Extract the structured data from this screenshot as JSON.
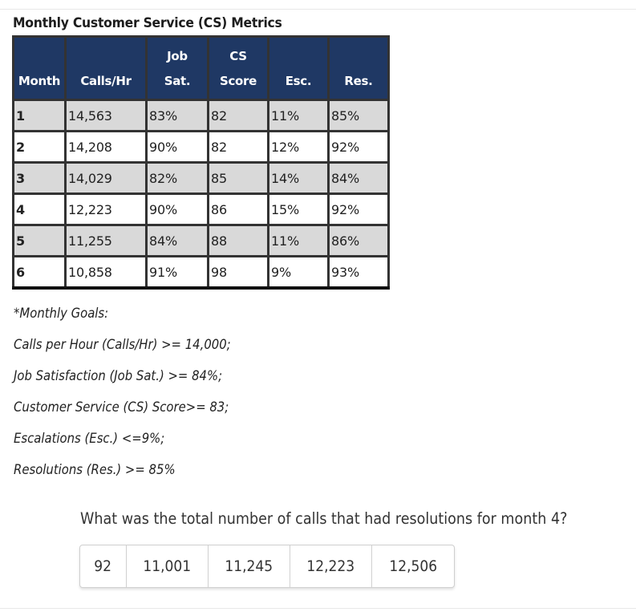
{
  "title": "Monthly Customer Service (CS) Metrics",
  "table": {
    "headers": [
      {
        "line1": "",
        "line2": "Month"
      },
      {
        "line1": "",
        "line2": "Calls/Hr"
      },
      {
        "line1": "Job",
        "line2": "Sat."
      },
      {
        "line1": "CS",
        "line2": "Score"
      },
      {
        "line1": "",
        "line2": "Esc."
      },
      {
        "line1": "",
        "line2": "Res."
      }
    ],
    "rows": [
      [
        "1",
        "14,563",
        "83%",
        "82",
        "11%",
        "85%"
      ],
      [
        "2",
        "14,208",
        "90%",
        "82",
        "12%",
        "92%"
      ],
      [
        "3",
        "14,029",
        "82%",
        "85",
        "14%",
        "84%"
      ],
      [
        "4",
        "12,223",
        "90%",
        "86",
        "15%",
        "92%"
      ],
      [
        "5",
        "11,255",
        "84%",
        "88",
        "11%",
        "86%"
      ],
      [
        "6",
        "10,858",
        "91%",
        "98",
        "9%",
        "93%"
      ]
    ],
    "header_color": "#1f3864",
    "shade_color": "#d9d9d9"
  },
  "goals": {
    "heading": "*Monthly Goals:",
    "items": [
      "Calls per Hour (Calls/Hr) >=  14,000;",
      "Job Satisfaction (Job Sat.) >= 84%;",
      "Customer Service (CS) Score>= 83;",
      "Escalations (Esc.) <=9%;",
      "Resolutions (Res.) >= 85%"
    ]
  },
  "question": "What was the total number of calls that had resolutions for month 4?",
  "choices": [
    "92",
    "11,001",
    "11,245",
    "12,223",
    "12,506"
  ]
}
